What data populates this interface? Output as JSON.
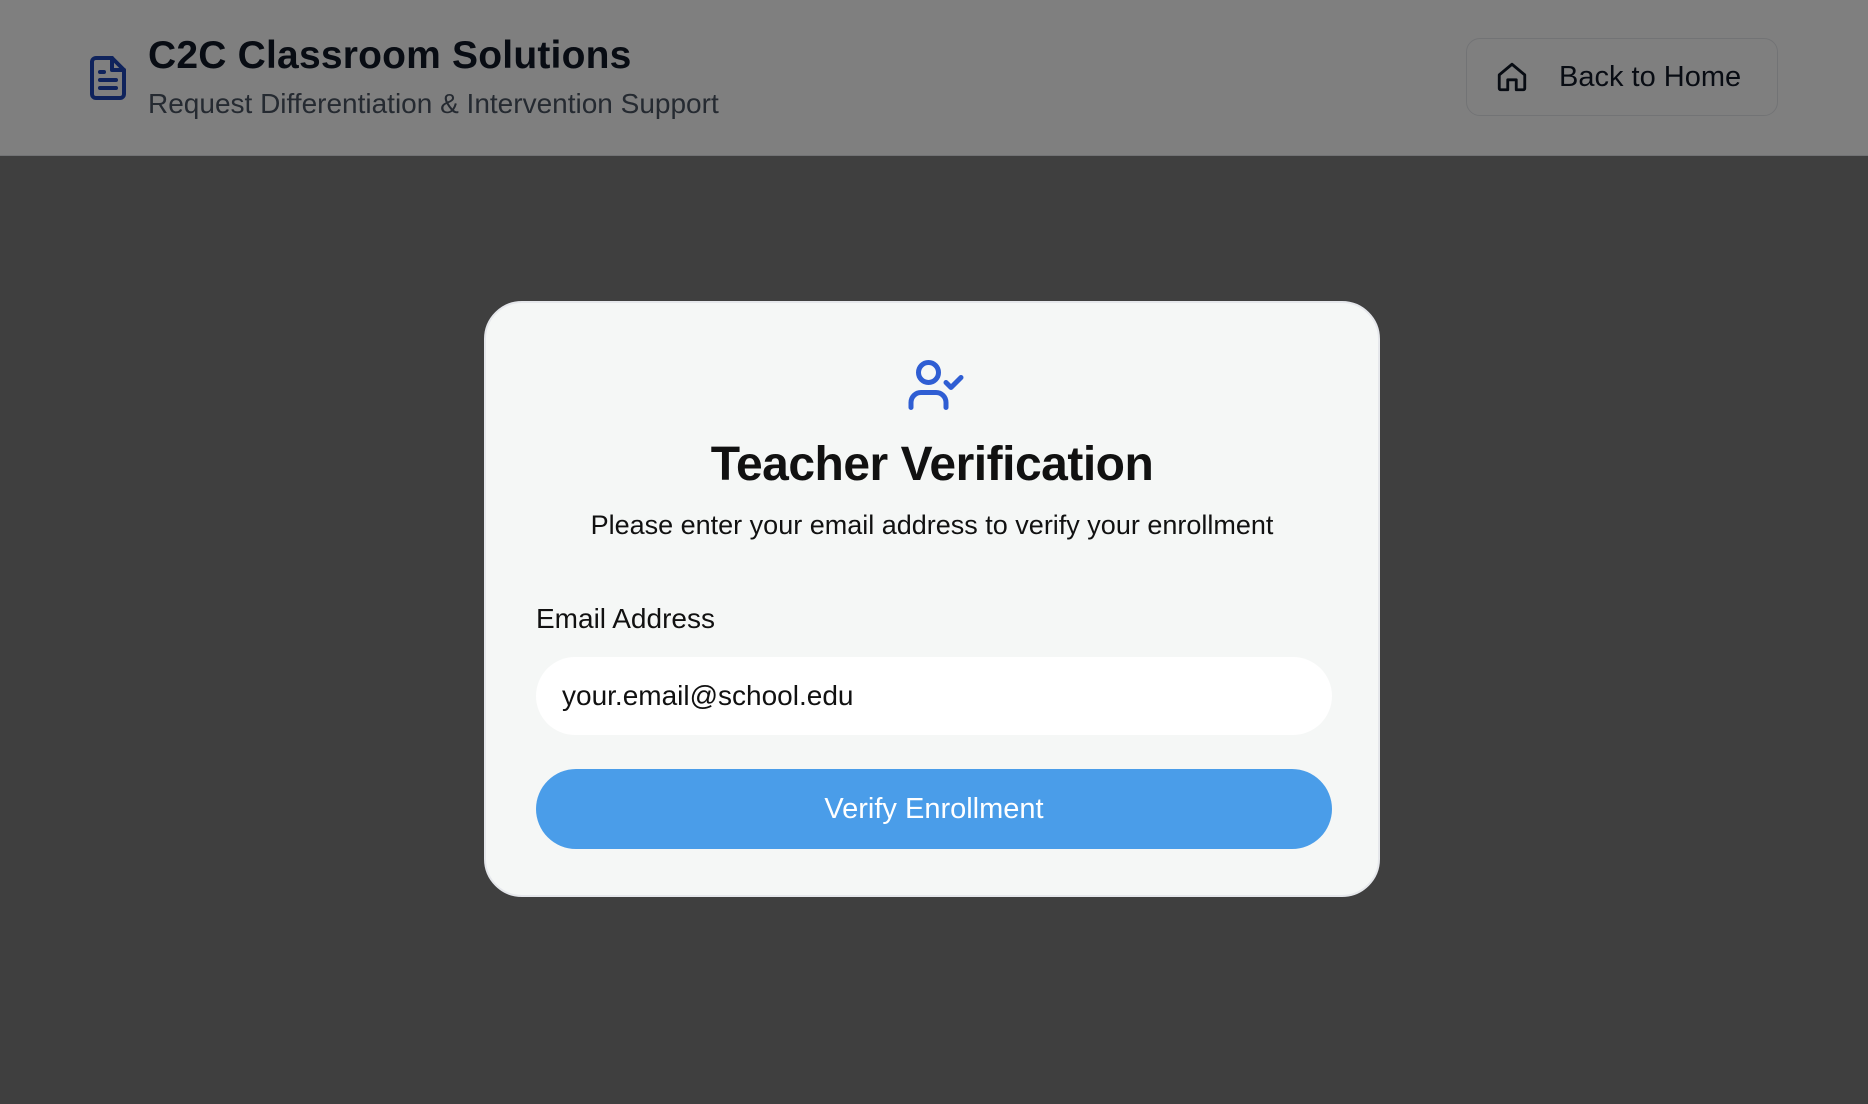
{
  "header": {
    "brand_icon": "document-icon",
    "title": "C2C Classroom Solutions",
    "subtitle": "Request Differentiation & Intervention Support",
    "home_button": {
      "icon": "home-icon",
      "label": "Back to Home"
    }
  },
  "modal": {
    "icon": "user-check-icon",
    "title": "Teacher Verification",
    "subtitle": "Please enter your email address to verify your enrollment",
    "email_label": "Email Address",
    "email_placeholder": "your.email@school.edu",
    "email_value": "",
    "submit_label": "Verify Enrollment"
  },
  "colors": {
    "accent": "#4a9de9",
    "icon_blue": "#2f5ed3",
    "overlay": "#7e7f7e",
    "modal_bg": "#f5f7f6"
  }
}
